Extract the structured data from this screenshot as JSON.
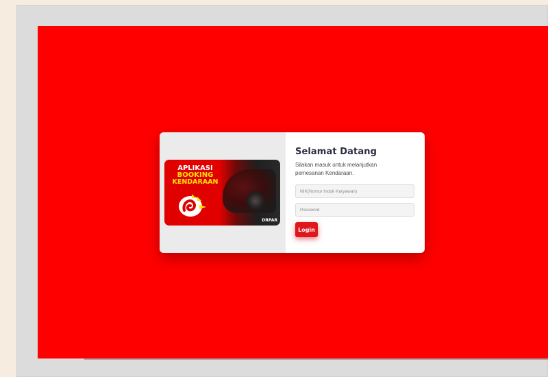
{
  "login": {
    "title": "Selamat Datang",
    "subtitle": "Silakan masuk untuk melanjutkan pemesanan Kendaraan.",
    "nik_placeholder": "NIK(Nomor Induk Karyawan)",
    "password_placeholder": "Password",
    "login_label": "Login"
  },
  "banner": {
    "line1": "APLIKASI",
    "line2": "BOOKING",
    "line3": "KENDARAAN",
    "brand": "DRPAR"
  },
  "colors": {
    "background": "#ff0000",
    "accent": "#e0181d",
    "title": "#2b2d42"
  }
}
